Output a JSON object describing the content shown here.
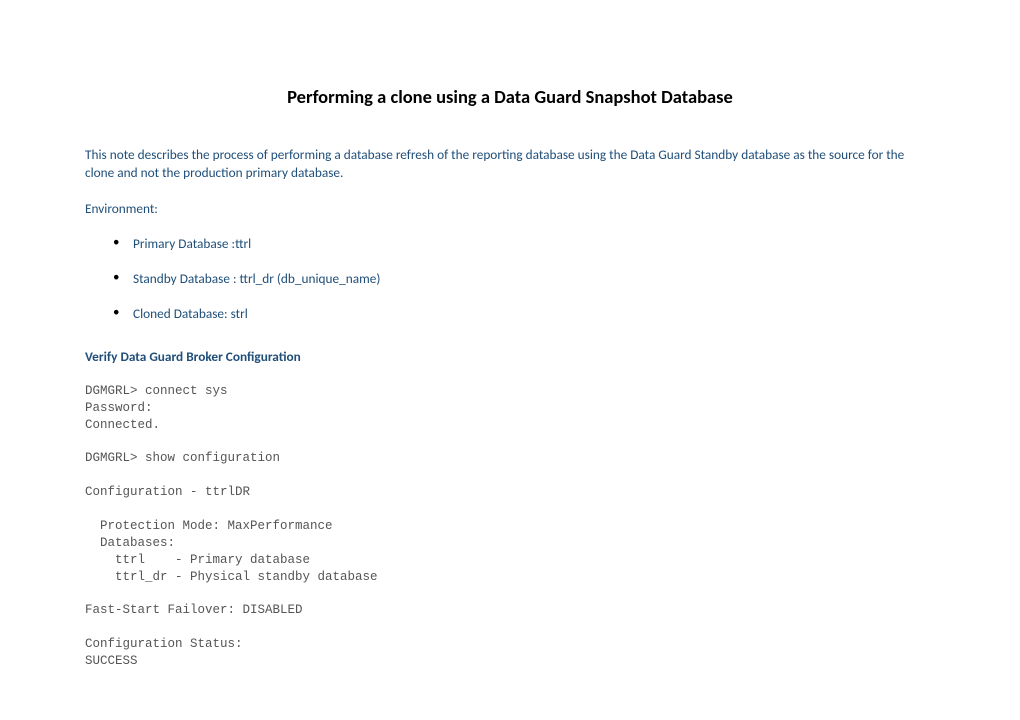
{
  "title": "Performing a clone using a Data Guard Snapshot Database",
  "intro": "This note describes the process of performing a database refresh of the reporting database using the Data Guard Standby database as the source for the clone and not the production primary database.",
  "env_label": "Environment:",
  "bullets": [
    "Primary Database :ttrl",
    "Standby Database : ttrl_dr (db_unique_name)",
    "Cloned Database: strl"
  ],
  "section_heading": "Verify Data Guard Broker Configuration",
  "code": "DGMGRL> connect sys\nPassword:\nConnected.\n\nDGMGRL> show configuration\n\nConfiguration - ttrlDR\n\n  Protection Mode: MaxPerformance\n  Databases:\n    ttrl    - Primary database\n    ttrl_dr - Physical standby database\n\nFast-Start Failover: DISABLED\n\nConfiguration Status:\nSUCCESS"
}
